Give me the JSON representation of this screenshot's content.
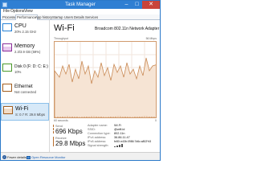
{
  "window": {
    "title": "Task Manager",
    "minimize_icon": "minimize-icon",
    "maximize_icon": "maximize-icon",
    "close_icon": "close-icon"
  },
  "menu": {
    "file": "File",
    "options": "Options",
    "view": "View"
  },
  "tabs": [
    {
      "label": "Processes"
    },
    {
      "label": "Performance"
    },
    {
      "label": "App history"
    },
    {
      "label": "Startup"
    },
    {
      "label": "Users"
    },
    {
      "label": "Details"
    },
    {
      "label": "Services"
    }
  ],
  "sidebar": {
    "items": [
      {
        "title": "CPU",
        "subtitle": "20% 2.15 GHz",
        "color": "#2a83d6"
      },
      {
        "title": "Memory",
        "subtitle": "2.3/3.9 GB (59%)",
        "color": "#8b2f9a"
      },
      {
        "title": "Disk 0 (F: D: C: E:)",
        "subtitle": "10%",
        "color": "#4b9a2b"
      },
      {
        "title": "Ethernet",
        "subtitle": "Not connected",
        "color": "#a35e1e"
      },
      {
        "title": "Wi-Fi",
        "subtitle": "S: 0.7 R: 29.8 Mbps",
        "color": "#a35e1e",
        "selected": true
      }
    ]
  },
  "main": {
    "title": "Wi-Fi",
    "adapter": "Broadcom 802.11n Network Adapter",
    "graph_label": "Throughput",
    "graph_max": "56 Mbps",
    "graph_time": "60 seconds",
    "graph_zero": "0",
    "send_label": "Send",
    "send_value": "696 Kbps",
    "receive_label": "Receive",
    "receive_value": "29.8 Mbps",
    "details": [
      {
        "label": "Adapter name:",
        "value": "Wi-Fi"
      },
      {
        "label": "SSID:",
        "value": "@wifi.id"
      },
      {
        "label": "Connection type:",
        "value": "802.11n"
      },
      {
        "label": "IPv4 address:",
        "value": "36.86.11.47"
      },
      {
        "label": "IPv6 address:",
        "value": "fe80::e43b:0986:7d6c:a802%3"
      },
      {
        "label": "Signal strength:",
        "value": ""
      }
    ],
    "graph_color": "#c98a55"
  },
  "footer": {
    "fewer_details": "Fewer details",
    "open_monitor": "Open Resource Monitor"
  }
}
